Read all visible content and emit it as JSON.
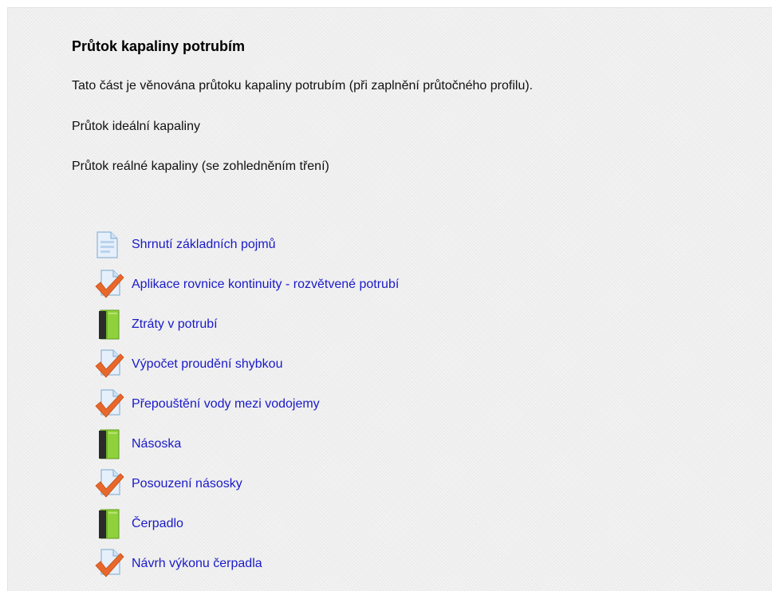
{
  "section": {
    "title": "Průtok kapaliny potrubím",
    "paragraphs": [
      "Tato část je věnována průtoku kapaliny potrubím (při zaplnění průtočného profilu).",
      "Průtok ideální kapaliny",
      "Průtok reálné kapaliny (se zohledněním tření)"
    ]
  },
  "activities": [
    {
      "label": "Shrnutí základních pojmů",
      "icon": "page-icon"
    },
    {
      "label": "Aplikace rovnice kontinuity - rozvětvené potrubí",
      "icon": "quiz-check-icon"
    },
    {
      "label": "Ztráty v potrubí",
      "icon": "book-icon"
    },
    {
      "label": "Výpočet proudění shybkou",
      "icon": "quiz-check-icon"
    },
    {
      "label": "Přepouštění vody mezi vodojemy",
      "icon": "quiz-check-icon"
    },
    {
      "label": "Násoska",
      "icon": "book-icon"
    },
    {
      "label": "Posouzení násosky",
      "icon": "quiz-check-icon"
    },
    {
      "label": "Čerpadlo",
      "icon": "book-icon"
    },
    {
      "label": "Návrh výkonu čerpadla",
      "icon": "quiz-check-icon"
    }
  ],
  "colors": {
    "link": "#1a1ac8",
    "panel_background": "#f3f3f3",
    "check": "#e8672a",
    "book_green": "#8fd13a"
  }
}
